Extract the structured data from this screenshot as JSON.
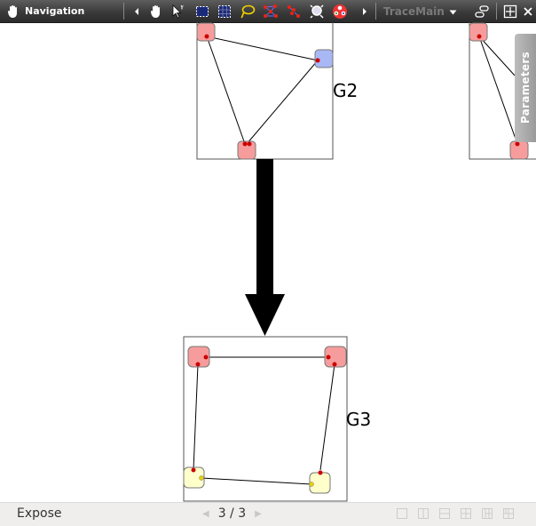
{
  "toolbar": {
    "title": "Navigation",
    "perspective": "TraceMain",
    "icons": [
      "hand-icon",
      "pointer-icon",
      "rect-select-icon",
      "grid-select-icon",
      "lasso-icon",
      "red-node-network-icon",
      "red-dots-icon",
      "magnifier-icon",
      "color-wheel-icon",
      "arrow-right-icon",
      "chevron-down-icon",
      "link-icon",
      "frame-icon",
      "close-icon"
    ]
  },
  "canvas": {
    "graphs": [
      {
        "label": "G2",
        "node_colors": [
          "#f79c9c",
          "#a8b8f5",
          "#f79c9c"
        ]
      },
      {
        "label": "G3",
        "node_colors": [
          "#f79c9c",
          "#f79c9c",
          "#ffffcc",
          "#ffffcc"
        ]
      }
    ],
    "accent_red": "#cc0000",
    "accent_yellow": "#e8d000"
  },
  "side_panel": {
    "label": "Parameters"
  },
  "status": {
    "mode": "Expose",
    "page": "3 / 3"
  }
}
